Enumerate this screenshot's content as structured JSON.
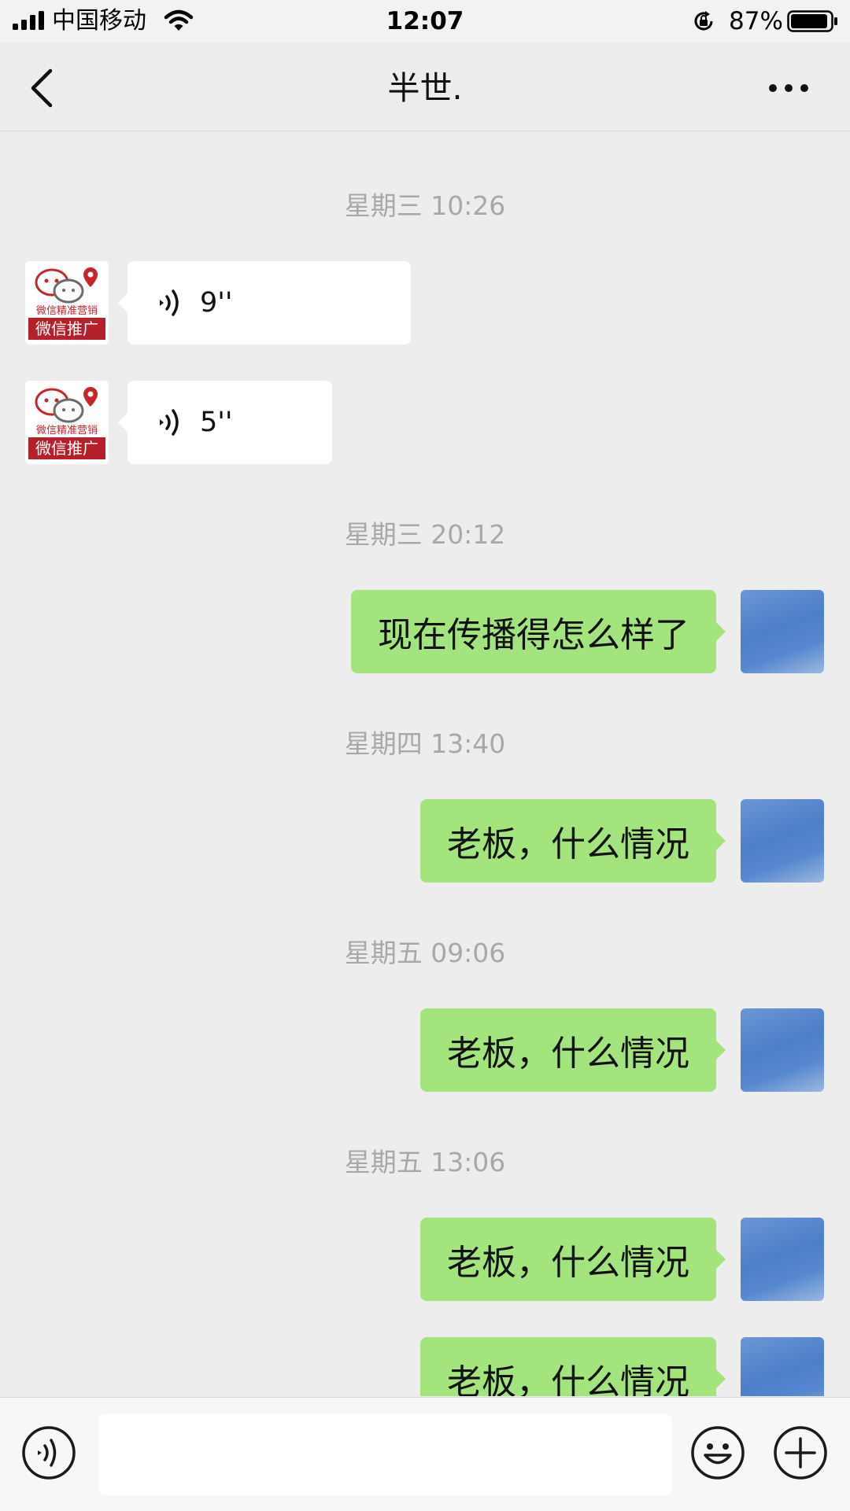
{
  "status_bar": {
    "carrier": "中国移动",
    "time": "12:07",
    "battery": "87%"
  },
  "nav": {
    "title": "半世."
  },
  "contact_avatar": {
    "line1": "微信精准营销",
    "line2": "微信推广"
  },
  "messages": [
    {
      "type": "time",
      "text": "星期三 10:26"
    },
    {
      "type": "voice",
      "side": "left",
      "duration": "9''"
    },
    {
      "type": "voice",
      "side": "left",
      "duration": "5''"
    },
    {
      "type": "time",
      "text": "星期三 20:12"
    },
    {
      "type": "text",
      "side": "right",
      "text": "现在传播得怎么样了"
    },
    {
      "type": "time",
      "text": "星期四 13:40"
    },
    {
      "type": "text",
      "side": "right",
      "text": "老板，什么情况"
    },
    {
      "type": "time",
      "text": "星期五 09:06"
    },
    {
      "type": "text",
      "side": "right",
      "text": "老板，什么情况"
    },
    {
      "type": "time",
      "text": "星期五 13:06"
    },
    {
      "type": "text",
      "side": "right",
      "text": "老板，什么情况"
    },
    {
      "type": "text",
      "side": "right",
      "text": "老板，什么情况"
    }
  ],
  "input_bar": {
    "text_value": "",
    "icons": [
      "voice-icon",
      "emoji-icon",
      "plus-icon"
    ]
  },
  "colors": {
    "background": "#ededed",
    "sent_bubble": "#a4e47d",
    "received_bubble": "#ffffff",
    "timestamp": "#a8a8a8"
  }
}
